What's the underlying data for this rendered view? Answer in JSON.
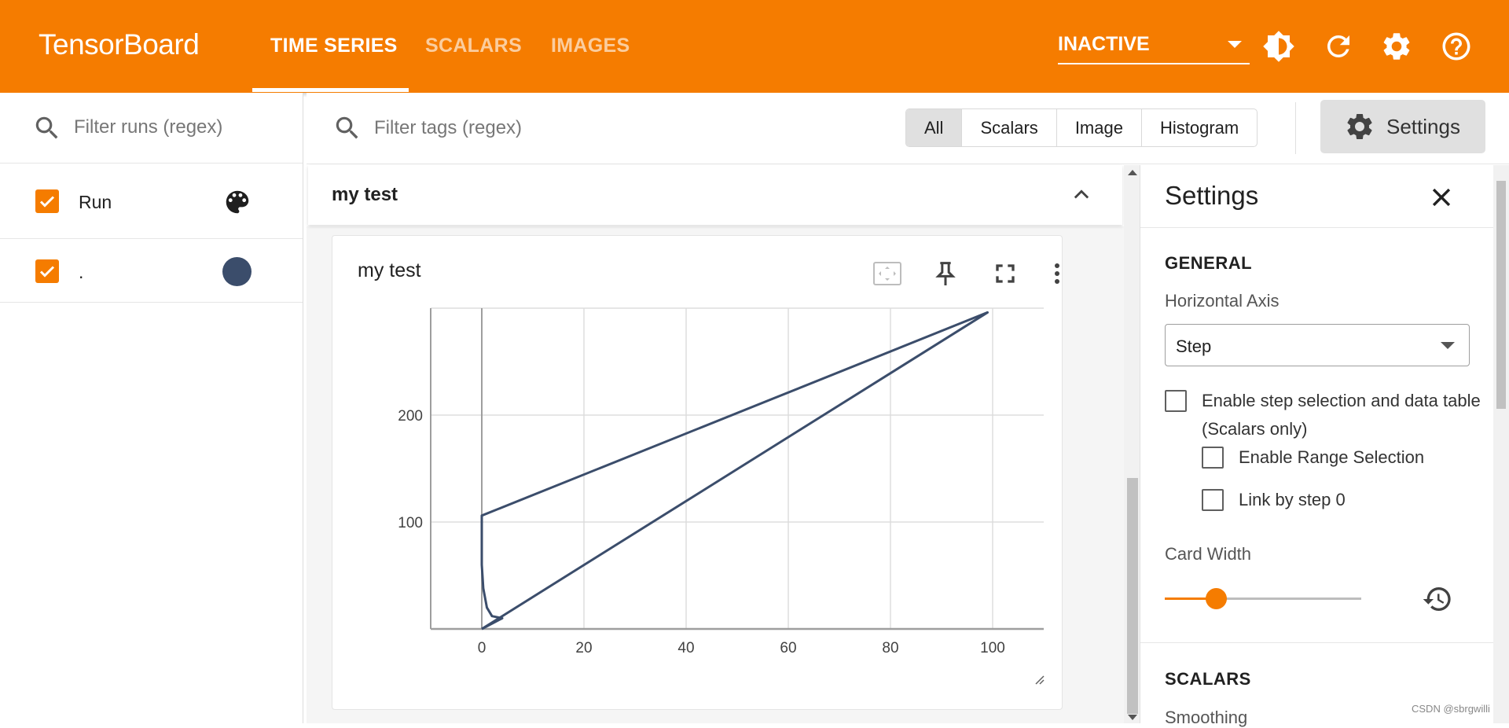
{
  "app": {
    "brand": "TensorBoard",
    "accent_color": "#f57c00",
    "tabs": [
      {
        "label": "TIME SERIES",
        "active": true
      },
      {
        "label": "SCALARS",
        "active": false
      },
      {
        "label": "IMAGES",
        "active": false
      }
    ],
    "run_status": "INACTIVE",
    "icons": [
      "brightness-icon",
      "refresh-icon",
      "gear-icon",
      "help-icon"
    ]
  },
  "runs": {
    "filter_placeholder": "Filter runs (regex)",
    "items": [
      {
        "label": "Run",
        "checked": true,
        "icon": "palette-icon"
      },
      {
        "label": ".",
        "checked": true,
        "color": "#3b4d6b"
      }
    ]
  },
  "main": {
    "filter_placeholder": "Filter tags (regex)",
    "type_filters": [
      "All",
      "Scalars",
      "Image",
      "Histogram"
    ],
    "selected_filter": "All",
    "settings_label": "Settings",
    "group": {
      "title": "my test"
    },
    "card": {
      "title": "my test",
      "icons": [
        "fit-domain-icon",
        "pin-icon",
        "fullscreen-icon",
        "more-vert-icon"
      ]
    }
  },
  "settings_panel": {
    "title": "Settings",
    "general_label": "GENERAL",
    "horizontal_axis_label": "Horizontal Axis",
    "horizontal_axis_value": "Step",
    "step_selection_label": "Enable step selection and data table",
    "step_selection_sub": "(Scalars only)",
    "range_selection_label": "Enable Range Selection",
    "link_step_label": "Link by step 0",
    "card_width_label": "Card Width",
    "card_width_fraction": 0.26,
    "scalars_label": "SCALARS",
    "smoothing_label": "Smoothing"
  },
  "watermark": "CSDN @sbrgwilli",
  "chart_data": {
    "type": "line",
    "x_ticks": [
      0,
      20,
      40,
      60,
      80,
      100
    ],
    "y_ticks": [
      100,
      200
    ],
    "xlim": [
      -10,
      110
    ],
    "ylim": [
      0,
      300
    ],
    "grid": true,
    "series": [
      {
        "color": "#3b4d6b",
        "x": [
          0,
          99,
          0,
          0,
          0.3,
          1,
          2,
          4,
          0
        ],
        "y": [
          106,
          296,
          106,
          60,
          38,
          20,
          12,
          10,
          0
        ]
      }
    ],
    "series_closing": {
      "x": [
        0,
        99
      ],
      "y": [
        0,
        296
      ]
    }
  }
}
